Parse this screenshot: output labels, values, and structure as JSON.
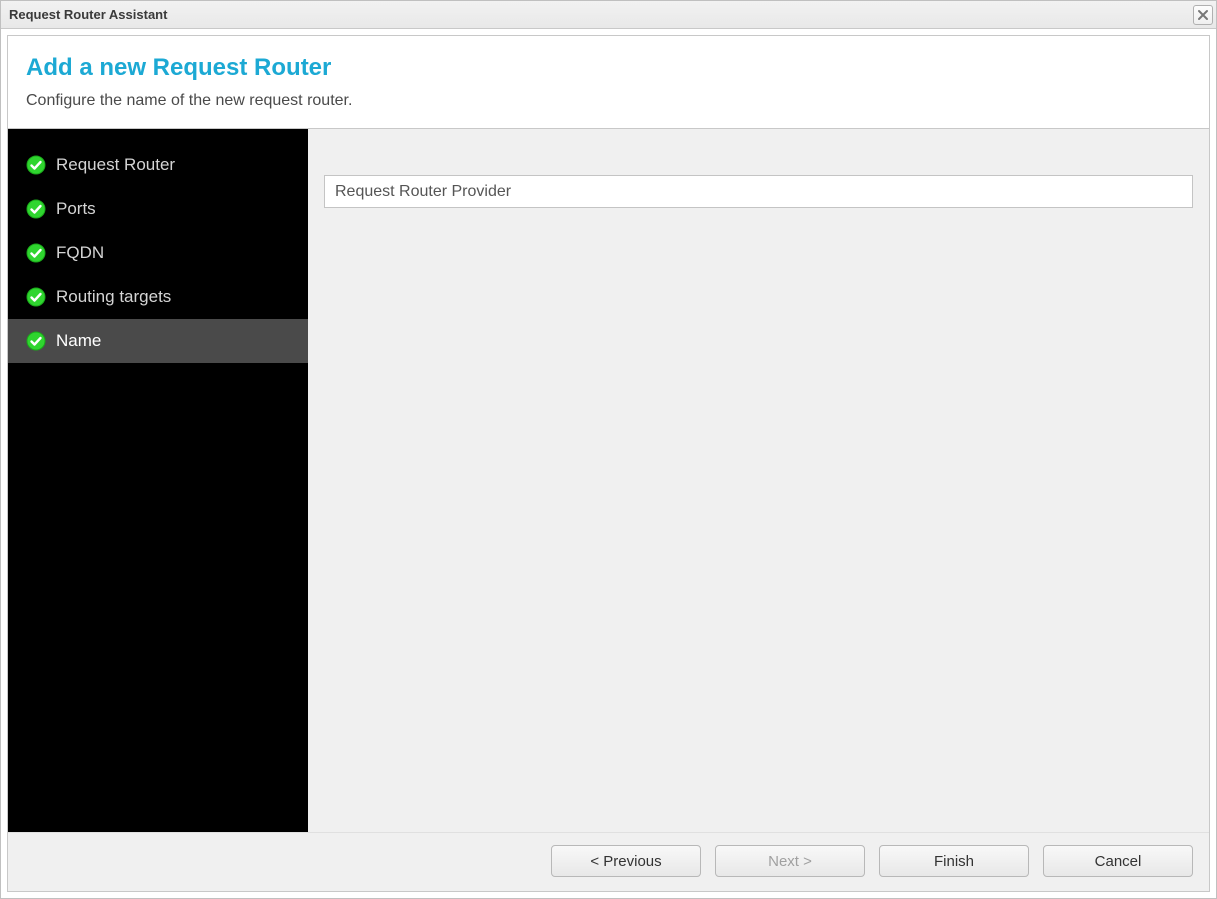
{
  "titlebar": {
    "title": "Request Router Assistant"
  },
  "header": {
    "title": "Add a new Request Router",
    "subtitle": "Configure the name of the new request router."
  },
  "sidebar": {
    "steps": [
      {
        "label": "Request Router",
        "completed": true,
        "active": false
      },
      {
        "label": "Ports",
        "completed": true,
        "active": false
      },
      {
        "label": "FQDN",
        "completed": true,
        "active": false
      },
      {
        "label": "Routing targets",
        "completed": true,
        "active": false
      },
      {
        "label": "Name",
        "completed": true,
        "active": true
      }
    ]
  },
  "content": {
    "name_input_value": "Request Router Provider"
  },
  "footer": {
    "previous": "< Previous",
    "next": "Next >",
    "next_disabled": true,
    "finish": "Finish",
    "cancel": "Cancel"
  },
  "icons": {
    "check": "check-icon",
    "close": "close-icon"
  },
  "colors": {
    "accent": "#1ca9d4",
    "step_ok": "#2fd52f"
  }
}
